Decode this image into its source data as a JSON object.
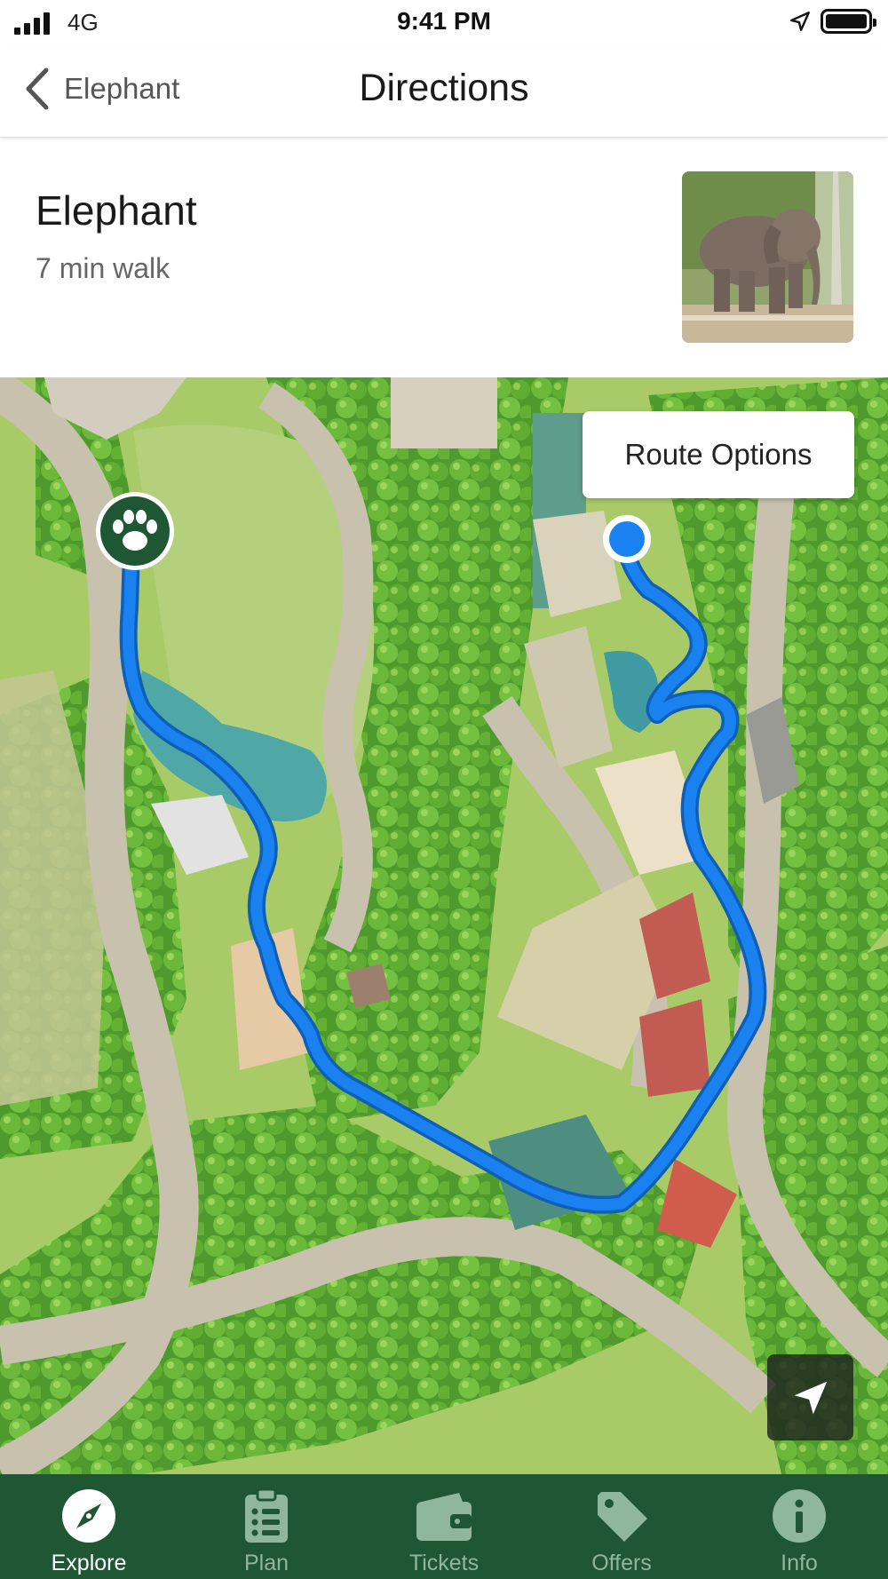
{
  "status_bar": {
    "network": "4G",
    "time": "9:41 PM",
    "location_icon": "location-arrow-icon",
    "battery_icon": "battery-full-icon"
  },
  "nav": {
    "back_label": "Elephant",
    "title": "Directions"
  },
  "destination": {
    "name": "Elephant",
    "walk_time": "7 min walk",
    "image_icon": "elephant-photo"
  },
  "map": {
    "route_options_label": "Route Options",
    "route_color": "#1a82f0",
    "current_location_color": "#1a82f0",
    "destination_marker_icon": "paw-icon",
    "locate_icon": "navigation-arrow-icon"
  },
  "tabs": [
    {
      "label": "Explore",
      "icon": "compass-icon",
      "active": true
    },
    {
      "label": "Plan",
      "icon": "checklist-icon",
      "active": false
    },
    {
      "label": "Tickets",
      "icon": "wallet-icon",
      "active": false
    },
    {
      "label": "Offers",
      "icon": "tag-icon",
      "active": false
    },
    {
      "label": "Info",
      "icon": "info-icon",
      "active": false
    }
  ],
  "colors": {
    "tab_bar": "#1f5734",
    "active_tab": "#ffffff",
    "inactive_tab": "#8fb79c"
  }
}
